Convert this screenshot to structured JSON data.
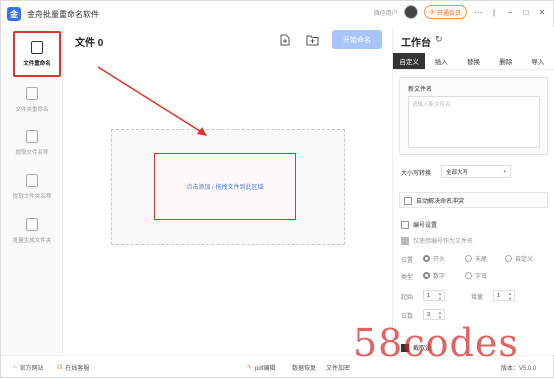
{
  "app": {
    "title": "金舟批量重命名软件",
    "logo_text": "金"
  },
  "titlebar": {
    "user_label": "微信用户",
    "member_label": "开通会员",
    "member_icon": "crown-icon"
  },
  "sidebar": {
    "items": [
      {
        "label": "文件重命名",
        "icon": "file-rename-icon"
      },
      {
        "label": "文件夹重命名",
        "icon": "folder-rename-icon"
      },
      {
        "label": "提取文件名称",
        "icon": "extract-file-icon"
      },
      {
        "label": "提取文件夹名称",
        "icon": "extract-folder-icon"
      },
      {
        "label": "批量生成文件夹",
        "icon": "batch-folder-icon"
      }
    ]
  },
  "main": {
    "title": "文件 0",
    "start_label": "开始命名",
    "drop_text": "点击添加 / 拖拽文件到此区域"
  },
  "panel": {
    "title": "工作台",
    "tabs": [
      "自定义",
      "插入",
      "替换",
      "删除",
      "导入"
    ],
    "new_name_label": "新文件名",
    "new_name_placeholder": "请输入新文件名",
    "case_label": "大小写转换",
    "case_value": "全部大写",
    "auto_conflict_label": "自动解决命名冲突",
    "numbering_label": "编号设置",
    "only_number_label": "仅使用编号作为文件名",
    "position_label": "位置",
    "position_options": [
      "开头",
      "末尾",
      "自定义"
    ],
    "type_label": "类型",
    "type_options": [
      "数字",
      "字母"
    ],
    "start_label": "起始",
    "start_value": "1",
    "step_label": "增量",
    "step_value": "1",
    "digits_label": "位数",
    "digits_value": "3",
    "cut_label": "截取设"
  },
  "footer": {
    "website": "官方网站",
    "service": "在线客服",
    "pdf": "pdf编辑",
    "data_recovery": "数据恢复",
    "encrypt": "文件加密",
    "version": "版本：V5.0.0"
  },
  "watermark": "58codes",
  "colors": {
    "accent": "#3a6ff0",
    "highlight": "#e0332b",
    "start_button": "#a9c3fb"
  }
}
